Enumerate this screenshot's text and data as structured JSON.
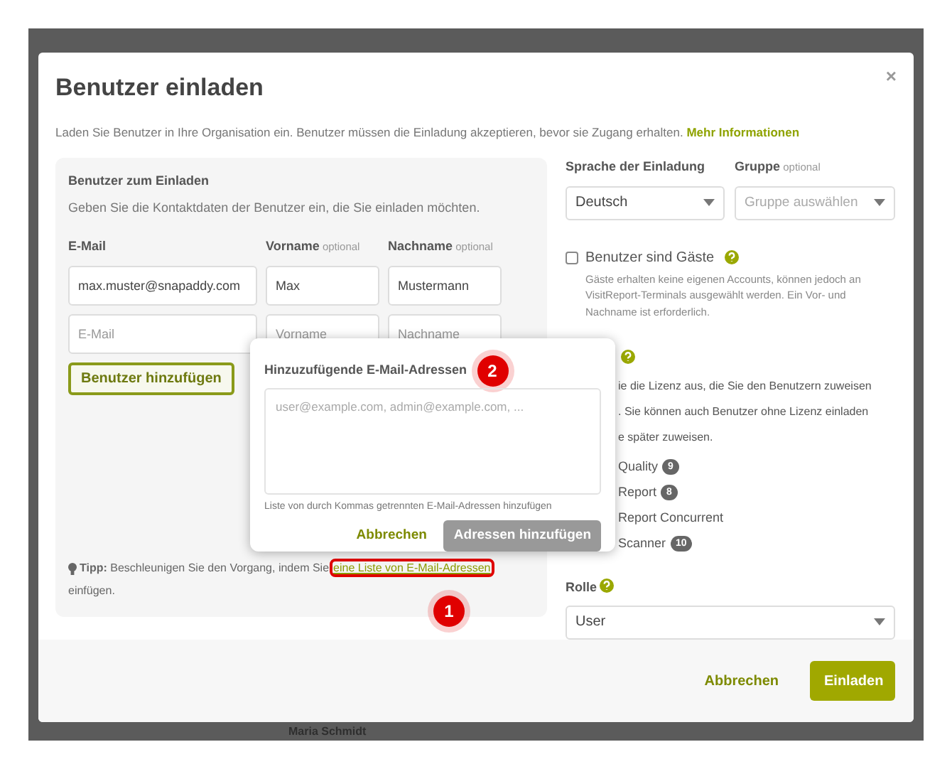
{
  "dialog": {
    "title": "Benutzer einladen",
    "close": "×",
    "description": "Laden Sie Benutzer in Ihre Organisation ein. Benutzer müssen die Einladung akzeptieren, bevor sie Zugang erhalten.",
    "more_link": "Mehr Informationen"
  },
  "users_panel": {
    "title": "Benutzer zum Einladen",
    "subtitle": "Geben Sie die Kontaktdaten der Benutzer ein, die Sie einladen möchten.",
    "columns": [
      {
        "label": "E-Mail"
      },
      {
        "label": "Vorname",
        "hint": "optional"
      },
      {
        "label": "Nachname",
        "hint": "optional"
      }
    ],
    "rows": [
      [
        {
          "value": "max.muster@snapaddy.com"
        },
        {
          "value": "Max"
        },
        {
          "value": "Mustermann"
        }
      ],
      [
        {
          "placeholder": "E-Mail"
        },
        {
          "placeholder": "Vorname"
        },
        {
          "placeholder": "Nachname"
        }
      ]
    ],
    "add_button": "Benutzer hinzufügen",
    "tip_label": "Tipp:",
    "tip_text": "Beschleunigen Sie den Vorgang, indem Sie",
    "tip_link": "eine Liste von E-Mail-Adressen",
    "tip_end": "einfügen."
  },
  "language": {
    "label": "Sprache der Einladung",
    "value": "Deutsch"
  },
  "group": {
    "label": "Gruppe",
    "hint": "optional",
    "placeholder": "Gruppe auswählen"
  },
  "guests": {
    "label": "Benutzer sind Gäste",
    "checked": false,
    "description": "Gäste erhalten keine eigenen Accounts, können jedoch an VisitReport-Terminals ausgewählt werden. Ein Vor- und Nachname ist erforderlich."
  },
  "license": {
    "description_lines": [
      "ie die Lizenz aus, die Sie den Benutzern zuweisen",
      ". Sie können auch Benutzer ohne Lizenz einladen",
      "e später zuweisen."
    ],
    "items": [
      {
        "label": "Quality",
        "count": "9"
      },
      {
        "label": "Report",
        "count": "8"
      },
      {
        "label": "Report Concurrent"
      },
      {
        "label": "Scanner",
        "count": "10"
      }
    ]
  },
  "role": {
    "label": "Rolle",
    "value": "User"
  },
  "footer": {
    "cancel": "Abbrechen",
    "submit": "Einladen"
  },
  "popover": {
    "title": "Hinzuzufügende E-Mail-Adressen",
    "placeholder": "user@example.com, admin@example.com, ...",
    "hint": "Liste von durch Kommas getrennten E-Mail-Adressen hinzufügen",
    "cancel": "Abbrechen",
    "submit": "Adressen hinzufügen",
    "submit_disabled": true
  },
  "markers": [
    {
      "label": "1"
    },
    {
      "label": "2"
    }
  ],
  "background": {
    "name": "Maria Schmidt"
  }
}
